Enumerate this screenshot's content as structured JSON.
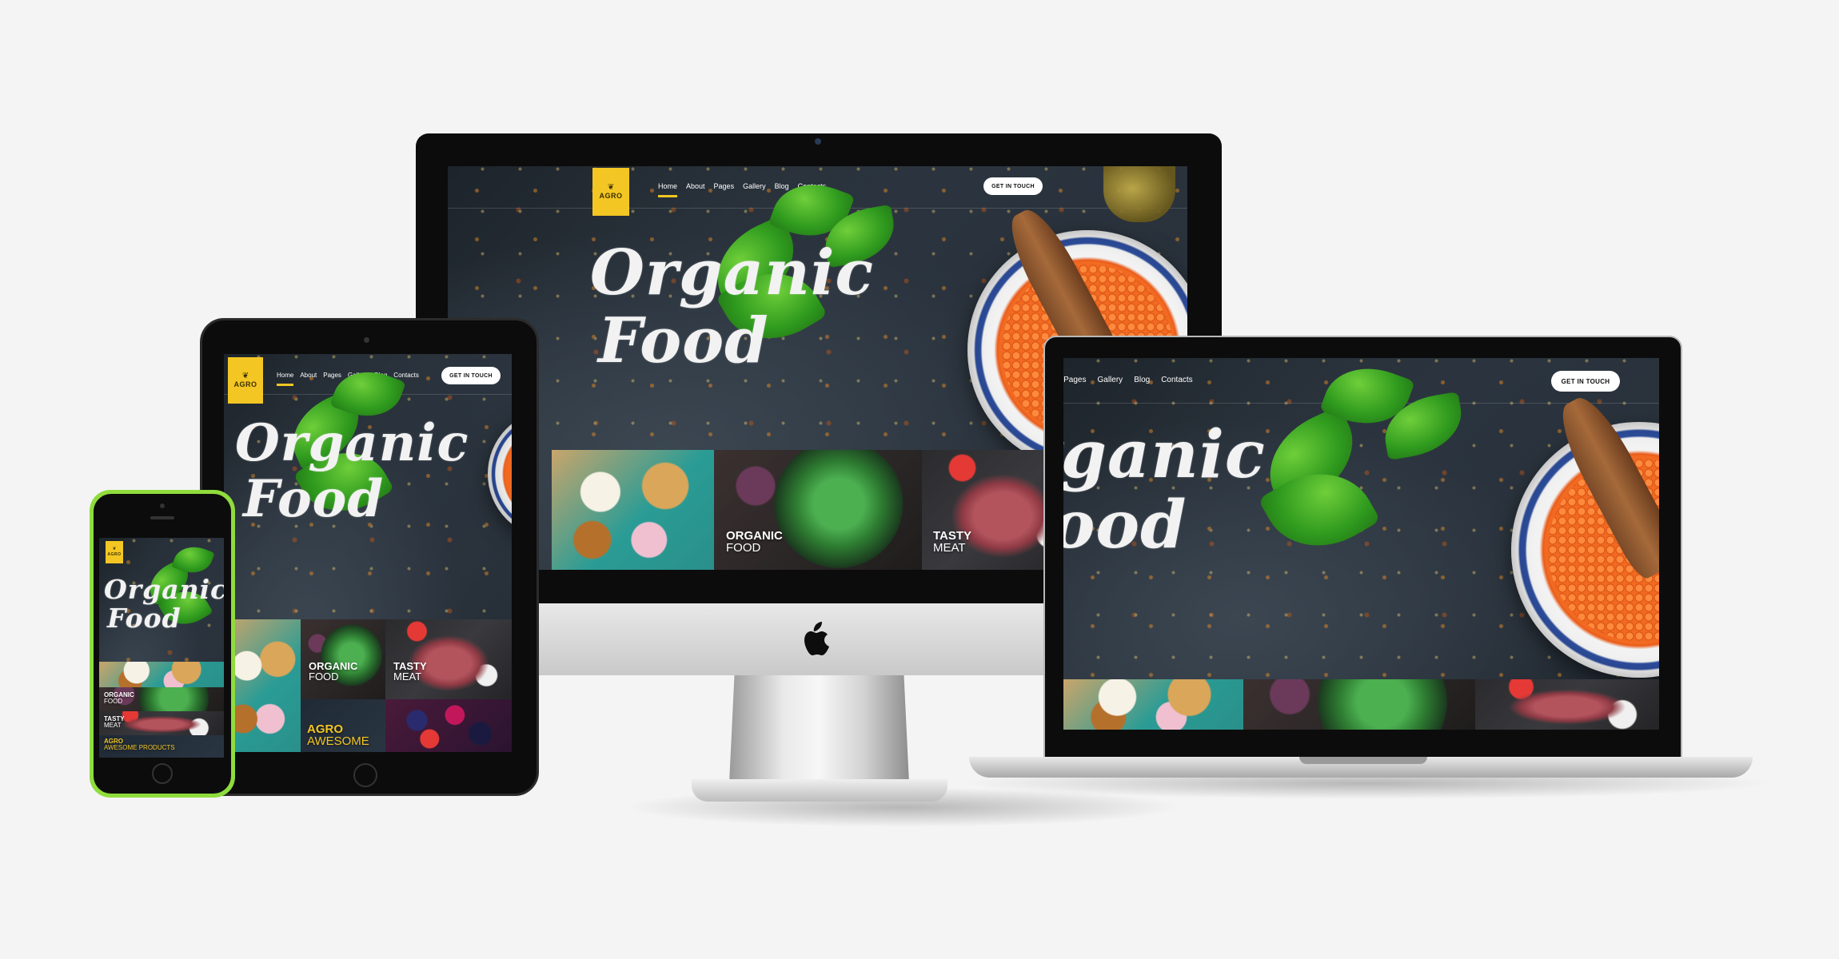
{
  "brand": {
    "logo_text": "AGRO",
    "accent": "#f3c623"
  },
  "nav": {
    "items": [
      "Home",
      "About",
      "Pages",
      "Gallery",
      "Blog",
      "Contacts"
    ],
    "active": "Home"
  },
  "cta_label": "GET IN TOUCH",
  "hero": {
    "line1": "Organic",
    "line2": "Food"
  },
  "tiles": {
    "organic": {
      "bold": "ORGANIC",
      "light": "FOOD"
    },
    "tasty": {
      "bold": "TASTY",
      "light": "MEAT"
    },
    "agro": {
      "bold": "AGRO",
      "light": "AWESOME"
    },
    "agro_phone_light": "AWESOME PRODUCTS"
  },
  "colors": {
    "background": "#f4f4f4",
    "site_dark": "#1d242b",
    "phone_case": "#8fdc3c",
    "device_silver": "#d8d8d8"
  },
  "icons": [
    "apple-logo-icon",
    "leaf-logo-icon",
    "camera-icon",
    "home-button-icon"
  ]
}
